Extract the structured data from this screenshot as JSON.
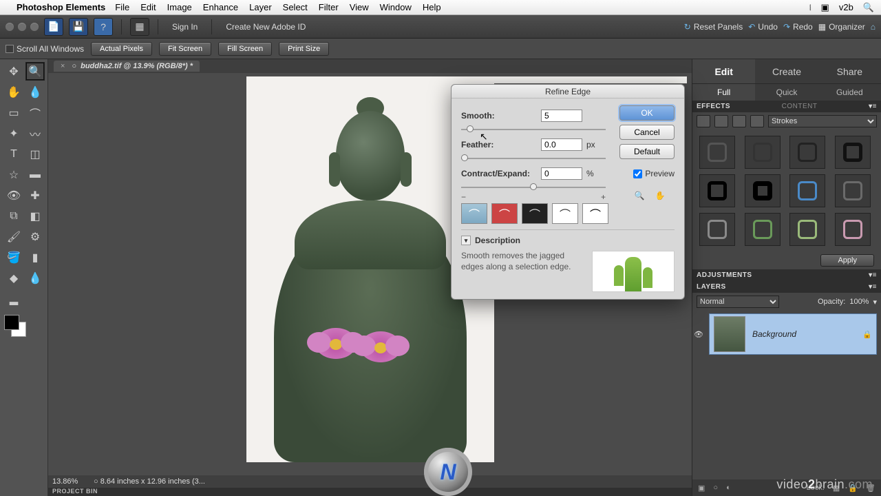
{
  "menubar": {
    "app": "Photoshop Elements",
    "items": [
      "File",
      "Edit",
      "Image",
      "Enhance",
      "Layer",
      "Select",
      "Filter",
      "View",
      "Window",
      "Help"
    ],
    "right_user": "v2b"
  },
  "toolbar": {
    "sign_in": "Sign In",
    "create_id": "Create New Adobe ID",
    "reset_panels": "Reset Panels",
    "undo": "Undo",
    "redo": "Redo",
    "organizer": "Organizer"
  },
  "options": {
    "scroll_all": "Scroll All Windows",
    "chips": [
      "Actual Pixels",
      "Fit Screen",
      "Fill Screen",
      "Print Size"
    ]
  },
  "document": {
    "tab_title": "buddha2.tif @ 13.9% (RGB/8*) *",
    "zoom": "13.86%",
    "status": "8.64 inches x 12.96 inches (3...",
    "project_bin": "PROJECT BIN"
  },
  "right_panel": {
    "tabs": [
      "Edit",
      "Create",
      "Share"
    ],
    "subtabs": [
      "Full",
      "Quick",
      "Guided"
    ],
    "effects_hdr": "EFFECTS",
    "content_hdr": "CONTENT",
    "effects_category": "Strokes",
    "apply_label": "Apply",
    "adjustments_hdr": "ADJUSTMENTS",
    "layers_hdr": "LAYERS",
    "blend_mode": "Normal",
    "opacity_label": "Opacity:",
    "opacity_value": "100%",
    "layer_name": "Background",
    "lock_label": "Lock:"
  },
  "dialog": {
    "title": "Refine Edge",
    "smooth_label": "Smooth:",
    "smooth_value": "5",
    "feather_label": "Feather:",
    "feather_value": "0.0",
    "feather_unit": "px",
    "contract_label": "Contract/Expand:",
    "contract_value": "0",
    "contract_unit": "%",
    "ok": "OK",
    "cancel": "Cancel",
    "default": "Default",
    "preview_chk": "Preview",
    "description_hdr": "Description",
    "description_body": "Smooth removes the jagged edges along a selection edge."
  },
  "watermark": {
    "brand1": "video",
    "brand2": "2",
    "brand3": "brain",
    "tld": ".com"
  }
}
